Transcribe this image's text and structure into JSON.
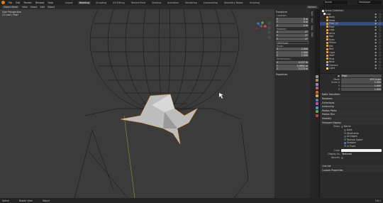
{
  "topbar": {
    "menus": [
      "File",
      "Edit",
      "Render",
      "Window",
      "Help"
    ],
    "workspaces": [
      "Layout",
      "Modeling",
      "Sculpting",
      "UV Editing",
      "Texture Paint",
      "Shading",
      "Animation",
      "Rendering",
      "Compositing",
      "Geometry Nodes",
      "Scripting"
    ],
    "active_workspace": "Modeling",
    "scene": "Scene",
    "view_layer": "ViewLayer"
  },
  "header": {
    "mode": "Object Mode",
    "menus": [
      "View",
      "Select",
      "Add",
      "Object"
    ],
    "options": "Options"
  },
  "viewport": {
    "view_name": "User Perspective",
    "collection": "(1) Last | Pixel"
  },
  "npanel": {
    "title": "Transform",
    "location_label": "Location:",
    "location": [
      {
        "axis": "X",
        "value": "0 m"
      },
      {
        "axis": "Y",
        "value": "0 m"
      },
      {
        "axis": "Z",
        "value": "0 m"
      }
    ],
    "rotation_label": "Rotation:",
    "rotation": [
      {
        "axis": "X",
        "value": "0°"
      },
      {
        "axis": "Y",
        "value": "0°"
      },
      {
        "axis": "Z",
        "value": "0°"
      }
    ],
    "rotation_mode": "XYZ Euler",
    "scale_label": "Scale:",
    "scale": [
      {
        "axis": "X",
        "value": "1.000"
      },
      {
        "axis": "Y",
        "value": "1.000"
      },
      {
        "axis": "Z",
        "value": "1.000"
      }
    ],
    "dimensions_label": "Dimensions:",
    "dimensions": [
      {
        "axis": "X",
        "value": "0.127 m"
      },
      {
        "axis": "Y",
        "value": "0.0651 m"
      },
      {
        "axis": "Z",
        "value": "0.173 m"
      }
    ],
    "properties_label": "Properties",
    "tabs": [
      "Item",
      "Tool",
      "View",
      "Edit"
    ]
  },
  "outliner": {
    "title": "Scene Collection",
    "items": [
      {
        "name": "Last",
        "color": "#dddddd",
        "selected": false
      },
      {
        "name": "Body",
        "color": "#e8a040",
        "selected": false
      },
      {
        "name": "Head",
        "color": "#e8a040",
        "selected": false
      },
      {
        "name": "Pixel_01",
        "color": "#e8a040",
        "selected": true
      },
      {
        "name": "Pixel",
        "color": "#e8a040",
        "selected": false
      },
      {
        "name": "Legs",
        "color": "#e8a040",
        "selected": false
      },
      {
        "name": "Arms",
        "color": "#e8a040",
        "selected": false
      },
      {
        "name": "Hair",
        "color": "#e8a040",
        "selected": false
      },
      {
        "name": "Eyes",
        "color": "#e8a040",
        "selected": false
      },
      {
        "name": "Shoes",
        "color": "#e8a040",
        "selected": false
      },
      {
        "name": "Hat",
        "color": "#e8a040",
        "selected": false
      },
      {
        "name": "Belt",
        "color": "#e8a040",
        "selected": false
      },
      {
        "name": "Cape",
        "color": "#e8a040",
        "selected": false
      },
      {
        "name": "Staff",
        "color": "#e8a040",
        "selected": false
      },
      {
        "name": "Ring",
        "color": "#e8a040",
        "selected": false
      },
      {
        "name": "Base",
        "color": "#e8a040",
        "selected": false
      },
      {
        "name": "Camera",
        "color": "#9aa0ff",
        "selected": false
      },
      {
        "name": "Light",
        "color": "#ffd75a",
        "selected": false
      }
    ]
  },
  "properties": {
    "object_name": "Pixel",
    "transform_sections": [
      {
        "label": "Mode",
        "value": "XYZ Euler"
      },
      {
        "label": "Scale X",
        "value": "1.000"
      },
      {
        "label": "Y",
        "value": "1.000"
      },
      {
        "label": "Z",
        "value": "1.000"
      }
    ],
    "panels": [
      "Delta Transform",
      "Relations",
      "Collections",
      "Instancing",
      "Motion Paths",
      "Motion Blur",
      "Visibility",
      "Viewport Display"
    ],
    "viewport_display": {
      "show_label": "Show",
      "checks": [
        {
          "label": "Name",
          "on": false
        },
        {
          "label": "Axes",
          "on": false
        },
        {
          "label": "Wireframe",
          "on": false
        },
        {
          "label": "All Edges",
          "on": false
        },
        {
          "label": "Texture Space",
          "on": false
        },
        {
          "label": "Shadow",
          "on": true
        },
        {
          "label": "In Front",
          "on": false
        }
      ],
      "color_label": "Color",
      "display_as_label": "Display As",
      "display_as_value": "Textured",
      "bounds_label": "Bounds"
    },
    "bottom_panels": [
      "Line Art",
      "Custom Properties"
    ]
  },
  "statusbar": {
    "items": [
      "Select",
      "Rotate View",
      "Object"
    ],
    "version": "3.6.1"
  }
}
